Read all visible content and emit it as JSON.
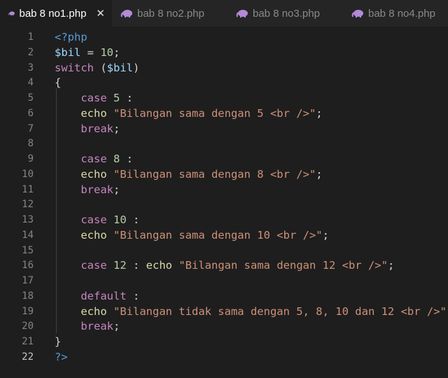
{
  "colors": {
    "editor_bg": "#1e1e1e",
    "tab_bar_bg": "#252526",
    "php_icon": "#b28ad6"
  },
  "tabs": [
    {
      "label": "bab 8 no1.php",
      "active": true,
      "icon": "php-elephant-icon",
      "close": "✕"
    },
    {
      "label": "bab 8 no2.php",
      "active": false,
      "icon": "php-elephant-icon"
    },
    {
      "label": "bab 8 no3.php",
      "active": false,
      "icon": "php-elephant-icon"
    },
    {
      "label": "bab 8 no4.php",
      "active": false,
      "icon": "php-elephant-icon"
    }
  ],
  "editor": {
    "current_line": 22,
    "lines": [
      {
        "n": "1",
        "tokens": [
          [
            "tag",
            "<?php"
          ]
        ]
      },
      {
        "n": "2",
        "tokens": [
          [
            "var",
            "$bil"
          ],
          [
            "op",
            " = "
          ],
          [
            "num",
            "10"
          ],
          [
            "pun",
            ";"
          ]
        ]
      },
      {
        "n": "3",
        "tokens": [
          [
            "kw",
            "switch"
          ],
          [
            "pun",
            " ("
          ],
          [
            "var",
            "$bil"
          ],
          [
            "pun",
            ")"
          ]
        ]
      },
      {
        "n": "4",
        "tokens": [
          [
            "pun",
            "{"
          ]
        ]
      },
      {
        "n": "5",
        "tokens": [
          [
            "pun",
            "    "
          ],
          [
            "kw",
            "case"
          ],
          [
            "pun",
            " "
          ],
          [
            "num",
            "5"
          ],
          [
            "pun",
            " :"
          ]
        ]
      },
      {
        "n": "6",
        "tokens": [
          [
            "pun",
            "    "
          ],
          [
            "fn",
            "echo"
          ],
          [
            "pun",
            " "
          ],
          [
            "str",
            "\"Bilangan sama dengan 5 <br />\""
          ],
          [
            "pun",
            ";"
          ]
        ]
      },
      {
        "n": "7",
        "tokens": [
          [
            "pun",
            "    "
          ],
          [
            "kw",
            "break"
          ],
          [
            "pun",
            ";"
          ]
        ]
      },
      {
        "n": "8",
        "tokens": []
      },
      {
        "n": "9",
        "tokens": [
          [
            "pun",
            "    "
          ],
          [
            "kw",
            "case"
          ],
          [
            "pun",
            " "
          ],
          [
            "num",
            "8"
          ],
          [
            "pun",
            " :"
          ]
        ]
      },
      {
        "n": "10",
        "tokens": [
          [
            "pun",
            "    "
          ],
          [
            "fn",
            "echo"
          ],
          [
            "pun",
            " "
          ],
          [
            "str",
            "\"Bilangan sama dengan 8 <br />\""
          ],
          [
            "pun",
            ";"
          ]
        ]
      },
      {
        "n": "11",
        "tokens": [
          [
            "pun",
            "    "
          ],
          [
            "kw",
            "break"
          ],
          [
            "pun",
            ";"
          ]
        ]
      },
      {
        "n": "12",
        "tokens": []
      },
      {
        "n": "13",
        "tokens": [
          [
            "pun",
            "    "
          ],
          [
            "kw",
            "case"
          ],
          [
            "pun",
            " "
          ],
          [
            "num",
            "10"
          ],
          [
            "pun",
            " :"
          ]
        ]
      },
      {
        "n": "14",
        "tokens": [
          [
            "pun",
            "    "
          ],
          [
            "fn",
            "echo"
          ],
          [
            "pun",
            " "
          ],
          [
            "str",
            "\"Bilangan sama dengan 10 <br />\""
          ],
          [
            "pun",
            ";"
          ]
        ]
      },
      {
        "n": "15",
        "tokens": []
      },
      {
        "n": "16",
        "tokens": [
          [
            "pun",
            "    "
          ],
          [
            "kw",
            "case"
          ],
          [
            "pun",
            " "
          ],
          [
            "num",
            "12"
          ],
          [
            "pun",
            " : "
          ],
          [
            "fn",
            "echo"
          ],
          [
            "pun",
            " "
          ],
          [
            "str",
            "\"Bilangan sama dengan 12 <br />\""
          ],
          [
            "pun",
            ";"
          ]
        ]
      },
      {
        "n": "17",
        "tokens": []
      },
      {
        "n": "18",
        "tokens": [
          [
            "pun",
            "    "
          ],
          [
            "kw",
            "default"
          ],
          [
            "pun",
            " :"
          ]
        ]
      },
      {
        "n": "19",
        "tokens": [
          [
            "pun",
            "    "
          ],
          [
            "fn",
            "echo"
          ],
          [
            "pun",
            " "
          ],
          [
            "str",
            "\"Bilangan tidak sama dengan 5, 8, 10 dan 12 <br />\""
          ],
          [
            "pun",
            ";"
          ]
        ]
      },
      {
        "n": "20",
        "tokens": [
          [
            "pun",
            "    "
          ],
          [
            "kw",
            "break"
          ],
          [
            "pun",
            ";"
          ]
        ]
      },
      {
        "n": "21",
        "tokens": [
          [
            "pun",
            "}"
          ]
        ]
      },
      {
        "n": "22",
        "tokens": [
          [
            "tag",
            "?>"
          ]
        ]
      }
    ]
  }
}
